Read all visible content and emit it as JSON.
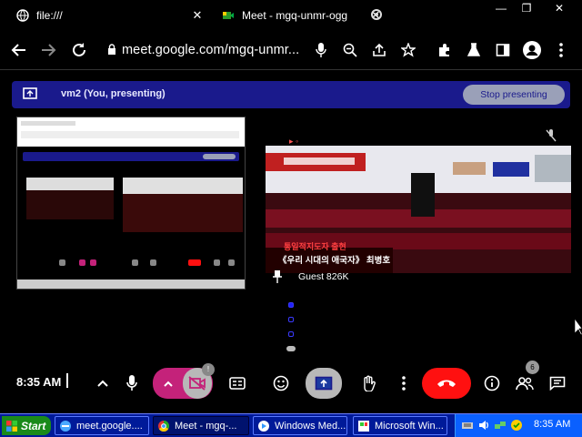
{
  "browser": {
    "tabs": [
      {
        "title": "file:///",
        "icon": "globe-icon"
      },
      {
        "title": "Meet - mgq-unmr-ogg",
        "icon": "meet-icon"
      }
    ],
    "url": "meet.google.com/mgq-unmr...",
    "window_controls": [
      "minimize",
      "restore",
      "close"
    ]
  },
  "meet": {
    "banner_text": "vm2 (You, presenting)",
    "stop_presenting_label": "Stop presenting",
    "guest_name": "Guest 826K",
    "video_caption_line1": "통일적지도자 출현",
    "video_caption_line2": "《우리 시대의 애국자》 최병호",
    "top_indicator": "▸ ◦",
    "clock": "8:35 AM",
    "camera_badge": "!",
    "participant_count": "6"
  },
  "taskbar": {
    "start_label": "Start",
    "tasks": [
      {
        "label": "meet.google....",
        "icon": "ie-icon"
      },
      {
        "label": "Meet - mgq-...",
        "icon": "chrome-icon"
      },
      {
        "label": "Windows Med...",
        "icon": "media-player-icon"
      },
      {
        "label": "Microsoft Win...",
        "icon": "windows-icon"
      }
    ],
    "time": "8:35 AM"
  },
  "colors": {
    "banner_bg": "#1a1a8c",
    "stop_btn_bg": "#9aa0b8",
    "camera_pink": "#c4227a",
    "hangup_red": "#ff1010",
    "taskbar_blue": "#001a99",
    "start_green": "#1a8a1a"
  }
}
